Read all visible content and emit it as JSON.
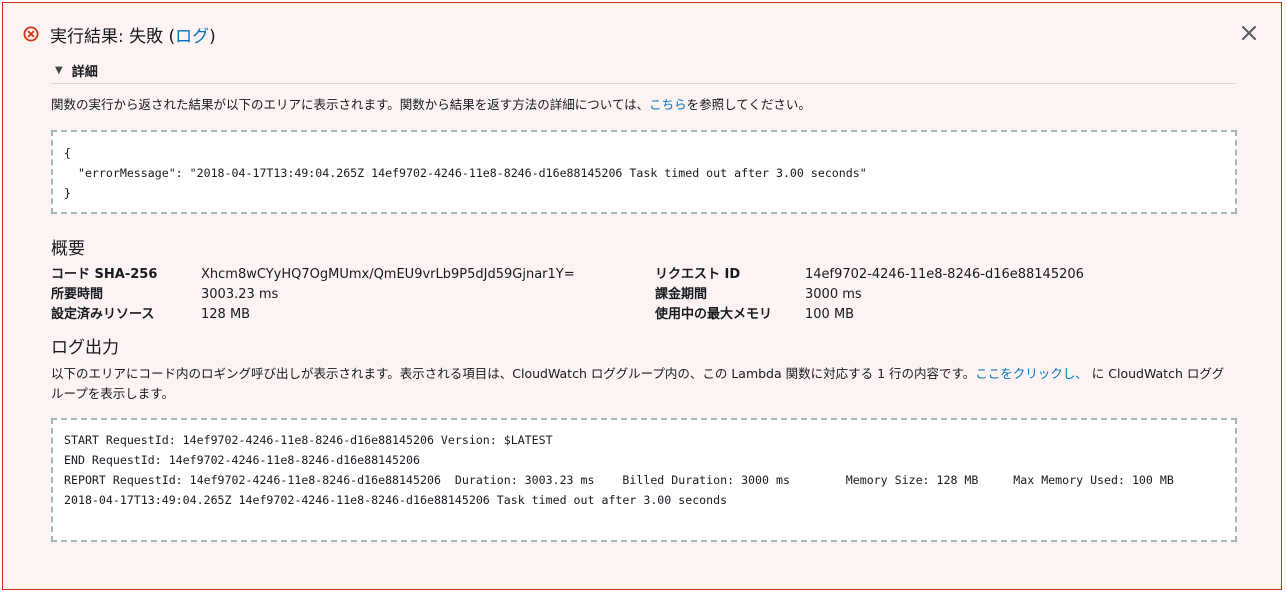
{
  "header": {
    "status_label": "実行結果: 失敗 (",
    "log_link": "ログ",
    "status_close": ")",
    "icon": "error-circle-x-icon",
    "error_color": "#d13212"
  },
  "details": {
    "toggle_label": "詳細",
    "desc_before": "関数の実行から返された結果が以下のエリアに表示されます。関数から結果を返す方法の詳細については、",
    "desc_link": "こちら",
    "desc_after": "を参照してください。",
    "result_json": "{\n  \"errorMessage\": \"2018-04-17T13:49:04.265Z 14ef9702-4246-11e8-8246-d16e88145206 Task timed out after 3.00 seconds\"\n}"
  },
  "summary": {
    "title": "概要",
    "rows": [
      {
        "k1": "コード SHA-256",
        "v1": "Xhcm8wCYyHQ7OgMUmx/QmEU9vrLb9P5dJd59Gjnar1Y=",
        "k2": "リクエスト ID",
        "v2": "14ef9702-4246-11e8-8246-d16e88145206"
      },
      {
        "k1": "所要時間",
        "v1": "3003.23 ms",
        "k2": "課金期間",
        "v2": "3000 ms"
      },
      {
        "k1": "設定済みリソース",
        "v1": "128 MB",
        "k2": "使用中の最大メモリ",
        "v2": "100 MB"
      }
    ]
  },
  "log_output": {
    "title": "ログ出力",
    "desc_before": "以下のエリアにコード内のロギング呼び出しが表示されます。表示される項目は、CloudWatch ロググループ内の、この Lambda 関数に対応する 1 行の内容です。",
    "desc_link": "ここをクリックし、",
    "desc_after": " に CloudWatch ロググループを表示します。",
    "log_text": "START RequestId: 14ef9702-4246-11e8-8246-d16e88145206 Version: $LATEST\nEND RequestId: 14ef9702-4246-11e8-8246-d16e88145206\nREPORT RequestId: 14ef9702-4246-11e8-8246-d16e88145206  Duration: 3003.23 ms    Billed Duration: 3000 ms        Memory Size: 128 MB     Max Memory Used: 100 MB\n2018-04-17T13:49:04.265Z 14ef9702-4246-11e8-8246-d16e88145206 Task timed out after 3.00 seconds"
  },
  "close_icon": "close-x-icon"
}
